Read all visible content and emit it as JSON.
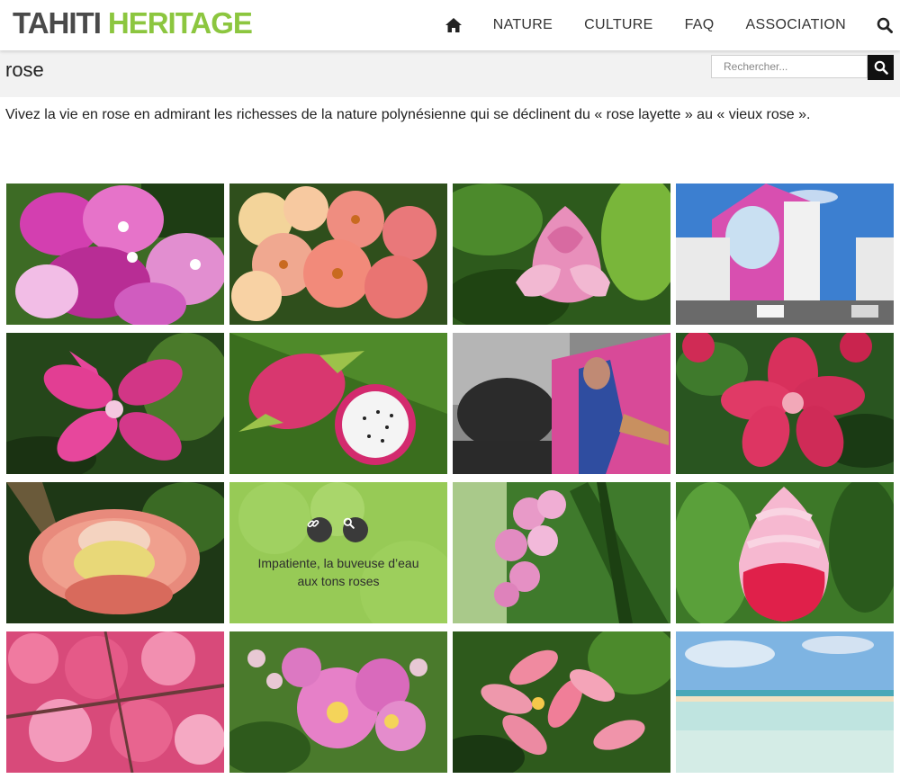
{
  "header": {
    "logo_part1": "TAHITI",
    "logo_part2": "HERITAGE",
    "nav": [
      "NATURE",
      "CULTURE",
      "FAQ",
      "ASSOCIATION"
    ],
    "icons": [
      "home-icon",
      "search-icon"
    ]
  },
  "page": {
    "title": "rose",
    "search_placeholder": "Rechercher...",
    "intro": "Vivez la vie en rose en admirant les richesses de la nature polynésienne qui se déclinent du « rose layette » au « vieux rose »."
  },
  "gallery": {
    "hovered_caption_line1": "Impatiente, la buveuse d’eau",
    "hovered_caption_line2": "aux tons roses",
    "overlay_icons": [
      "link-icon",
      "zoom-icon"
    ],
    "accent": "#8cc63f"
  }
}
